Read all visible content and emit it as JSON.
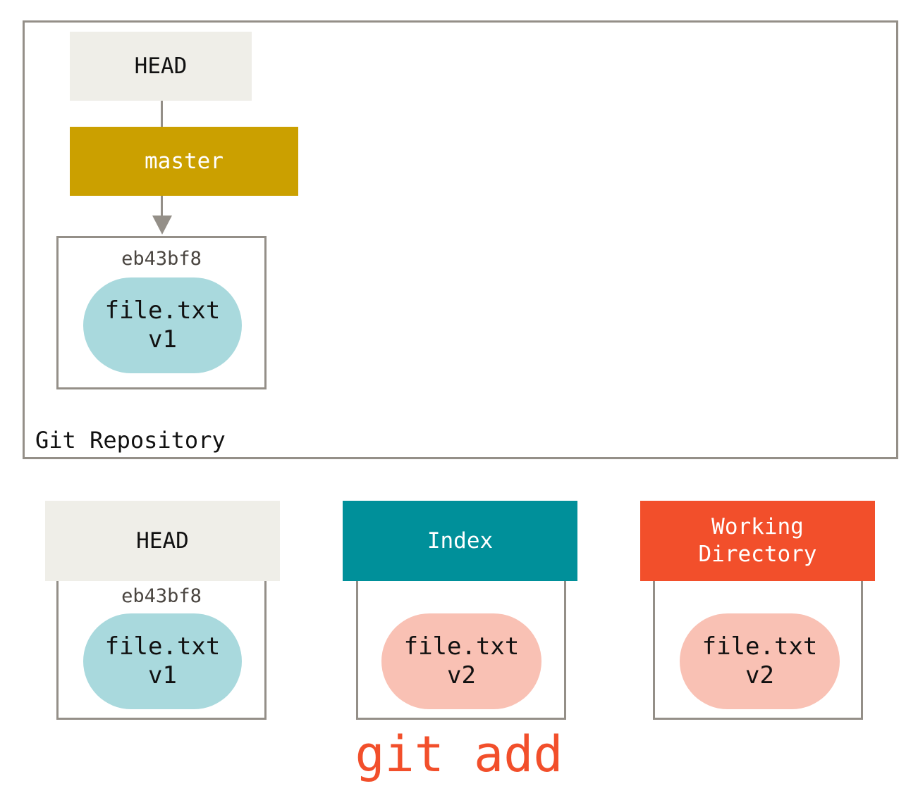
{
  "repository": {
    "label": "Git Repository",
    "head_label": "HEAD",
    "branch_label": "master",
    "commit": {
      "sha": "eb43bf8",
      "file_name": "file.txt",
      "file_version": "v1"
    }
  },
  "trees": [
    {
      "name": "HEAD",
      "sha": "eb43bf8",
      "file_name": "file.txt",
      "file_version": "v1"
    },
    {
      "name": "Index",
      "file_name": "file.txt",
      "file_version": "v2"
    },
    {
      "name_line1": "Working",
      "name_line2": "Directory",
      "file_name": "file.txt",
      "file_version": "v2"
    }
  ],
  "command": "git add",
  "colors": {
    "head_bg": "#efeee8",
    "branch_bg": "#cba000",
    "index_bg": "#00909a",
    "working_dir_bg": "#f24f2b",
    "blob_v1": "#a9d9dd",
    "blob_v2": "#f9c1b4",
    "border": "#948f88",
    "command": "#f24f2b"
  }
}
